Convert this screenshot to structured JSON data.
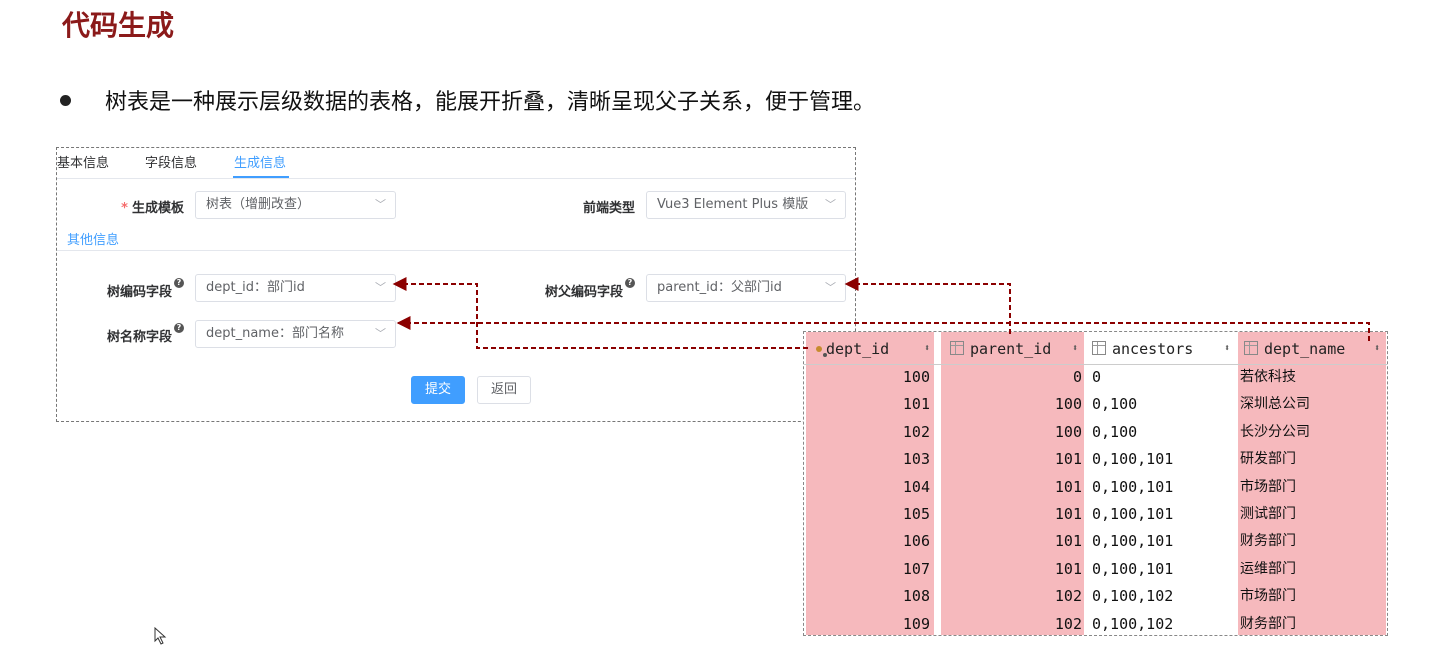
{
  "slide": {
    "title": "代码生成",
    "bullet": "树表是一种展示层级数据的表格，能展开折叠，清晰呈现父子关系，便于管理。"
  },
  "form": {
    "tabs": [
      {
        "label": "基本信息"
      },
      {
        "label": "字段信息"
      },
      {
        "label": "生成信息"
      }
    ],
    "template_label": "生成模板",
    "template_value": "树表（增删改查）",
    "frontend_label": "前端类型",
    "frontend_value": "Vue3 Element Plus 模版",
    "section_other": "其他信息",
    "tree_code_label": "树编码字段",
    "tree_code_value": "dept_id：部门id",
    "tree_parent_label": "树父编码字段",
    "tree_parent_value": "parent_id：父部门id",
    "tree_name_label": "树名称字段",
    "tree_name_value": "dept_name：部门名称",
    "submit_label": "提交",
    "back_label": "返回"
  },
  "table": {
    "columns": [
      "dept_id",
      "parent_id",
      "ancestors",
      "dept_name"
    ],
    "rows": [
      [
        "100",
        "0",
        "0",
        "若依科技"
      ],
      [
        "101",
        "100",
        "0,100",
        "深圳总公司"
      ],
      [
        "102",
        "100",
        "0,100",
        "长沙分公司"
      ],
      [
        "103",
        "101",
        "0,100,101",
        "研发部门"
      ],
      [
        "104",
        "101",
        "0,100,101",
        "市场部门"
      ],
      [
        "105",
        "101",
        "0,100,101",
        "测试部门"
      ],
      [
        "106",
        "101",
        "0,100,101",
        "财务部门"
      ],
      [
        "107",
        "101",
        "0,100,101",
        "运维部门"
      ],
      [
        "108",
        "102",
        "0,100,102",
        "市场部门"
      ],
      [
        "109",
        "102",
        "0,100,102",
        "财务部门"
      ]
    ]
  },
  "colors": {
    "title": "#8b1a1a",
    "accent": "#409eff",
    "highlight": "#f6b9bd",
    "arrow": "#8b0000"
  }
}
